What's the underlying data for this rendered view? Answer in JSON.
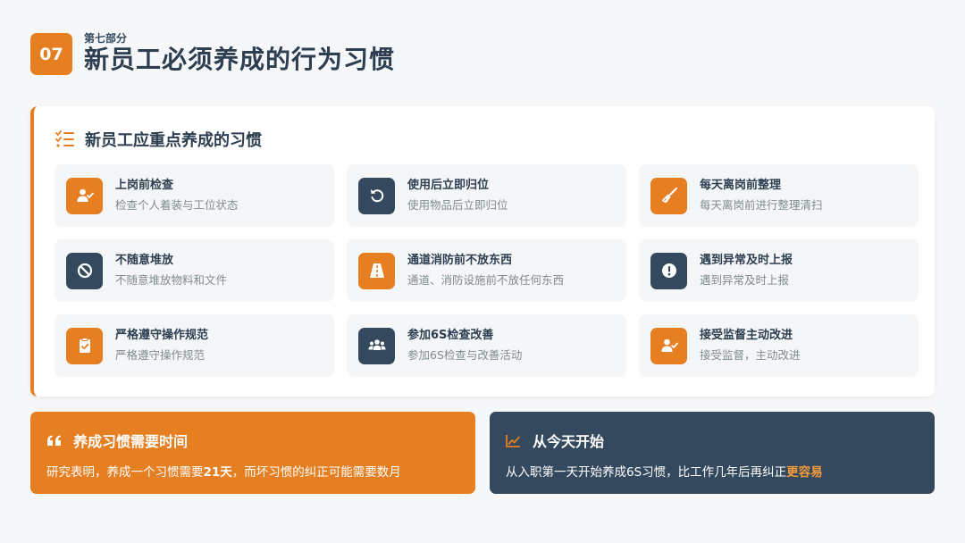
{
  "header": {
    "number": "07",
    "section_label": "第七部分",
    "title": "新员工必须养成的行为习惯"
  },
  "main_card": {
    "title": "新员工应重点养成的习惯",
    "items": [
      {
        "icon": "user-check-icon",
        "color": "#e67e22",
        "title": "上岗前检查",
        "desc": "检查个人着装与工位状态"
      },
      {
        "icon": "undo-icon",
        "color": "#34495e",
        "title": "使用后立即归位",
        "desc": "使用物品后立即归位"
      },
      {
        "icon": "broom-icon",
        "color": "#e67e22",
        "title": "每天离岗前整理",
        "desc": "每天离岗前进行整理清扫"
      },
      {
        "icon": "ban-icon",
        "color": "#34495e",
        "title": "不随意堆放",
        "desc": "不随意堆放物料和文件"
      },
      {
        "icon": "road-icon",
        "color": "#e67e22",
        "title": "通道消防前不放东西",
        "desc": "通道、消防设施前不放任何东西"
      },
      {
        "icon": "exclamation-icon",
        "color": "#34495e",
        "title": "遇到异常及时上报",
        "desc": "遇到异常及时上报"
      },
      {
        "icon": "clipboard-check-icon",
        "color": "#e67e22",
        "title": "严格遵守操作规范",
        "desc": "严格遵守操作规范"
      },
      {
        "icon": "users-icon",
        "color": "#34495e",
        "title": "参加6S检查改善",
        "desc": "参加6S检查与改善活动"
      },
      {
        "icon": "user-check-icon",
        "color": "#e67e22",
        "title": "接受监督主动改进",
        "desc": "接受监督，主动改进"
      }
    ]
  },
  "bottom_left": {
    "title": "养成习惯需要时间",
    "text_before": "研究表明，养成一个习惯需要",
    "text_bold": "21天",
    "text_after": "，而坏习惯的纠正可能需要数月"
  },
  "bottom_right": {
    "title": "从今天开始",
    "text_before": "从入职第一天开始养成6S习惯，比工作几年后再纠正",
    "text_highlight": "更容易"
  },
  "colors": {
    "accent": "#e67e22",
    "navy": "#34495e",
    "background": "#f6f7f9"
  }
}
